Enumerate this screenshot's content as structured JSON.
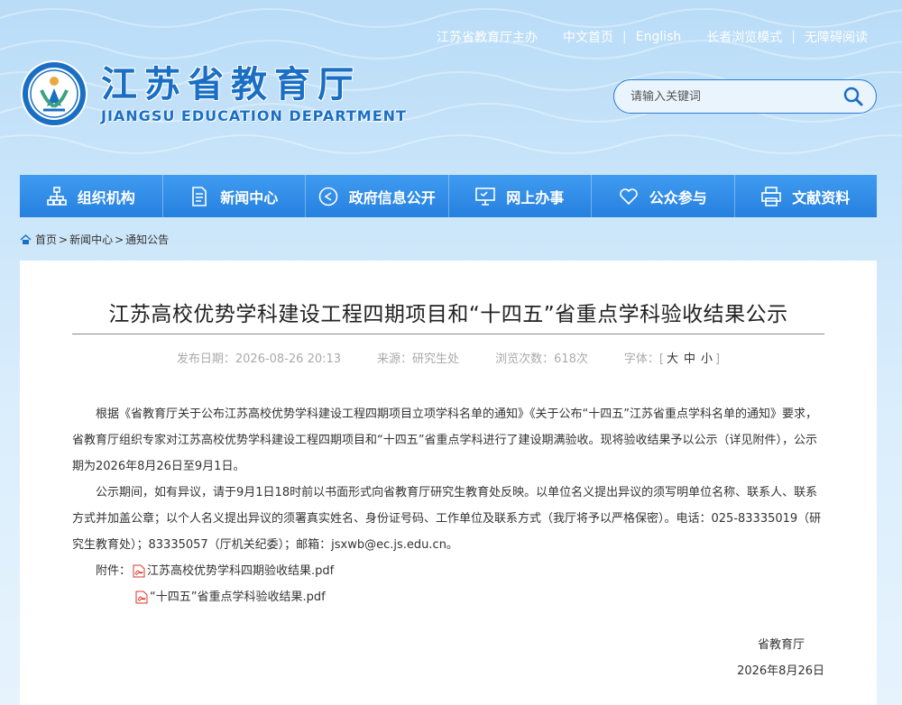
{
  "top_links": {
    "sponsor": "江苏省教育厅主办",
    "home": "中文首页",
    "english": "English",
    "elder_mode": "长者浏览模式",
    "accessible": "无障碍阅读"
  },
  "logo": {
    "cn": "江苏省教育厅",
    "en": "JIANGSU EDUCATION DEPARTMENT"
  },
  "search": {
    "placeholder": "请输入关键词"
  },
  "nav": [
    {
      "label": "组织机构",
      "icon": "org-chart-icon"
    },
    {
      "label": "新闻中心",
      "icon": "document-icon"
    },
    {
      "label": "政府信息公开",
      "icon": "play-circle-icon"
    },
    {
      "label": "网上办事",
      "icon": "monitor-icon"
    },
    {
      "label": "公众参与",
      "icon": "heart-icon"
    },
    {
      "label": "文献资料",
      "icon": "printer-icon"
    }
  ],
  "breadcrumb": {
    "home": "首页",
    "sep": ">",
    "news": "新闻中心",
    "notice": "通知公告"
  },
  "article": {
    "title": "江苏高校优势学科建设工程四期项目和“十四五”省重点学科验收结果公示",
    "publish_date": "发布日期：2026-08-26 20:13",
    "source": "来源：研究生处",
    "views": "浏览次数：618次",
    "font_label": "字体：[",
    "font_large": "大",
    "font_medium": "中",
    "font_small": "小",
    "font_close": "]",
    "para1": "根据《省教育厅关于公布江苏高校优势学科建设工程四期项目立项学科名单的通知》《关于公布“十四五”江苏省重点学科名单的通知》要求，省教育厅组织专家对江苏高校优势学科建设工程四期项目和“十四五”省重点学科进行了建设期满验收。现将验收结果予以公示（详见附件），公示期为2026年8月26日至9月1日。",
    "para2": "公示期间，如有异议，请于9月1日18时前以书面形式向省教育厅研究生教育处反映。以单位名义提出异议的须写明单位名称、联系人、联系方式并加盖公章；以个人名义提出异议的须署真实姓名、身份证号码、工作单位及联系方式（我厅将予以严格保密）。电话：025-83335019（研究生教育处）；83335057（厅机关纪委）；邮箱：jsxwb@ec.js.edu.cn。",
    "attach_label": "附件：",
    "attachment1": "江苏高校优势学科四期验收结果.pdf",
    "attachment2": "“十四五”省重点学科验收结果.pdf",
    "sign_org": "省教育厅",
    "sign_date": "2026年8月26日"
  },
  "colors": {
    "brand_blue": "#1a6fc4",
    "nav_blue": "#2680df",
    "pdf_red": "#d9342b"
  }
}
